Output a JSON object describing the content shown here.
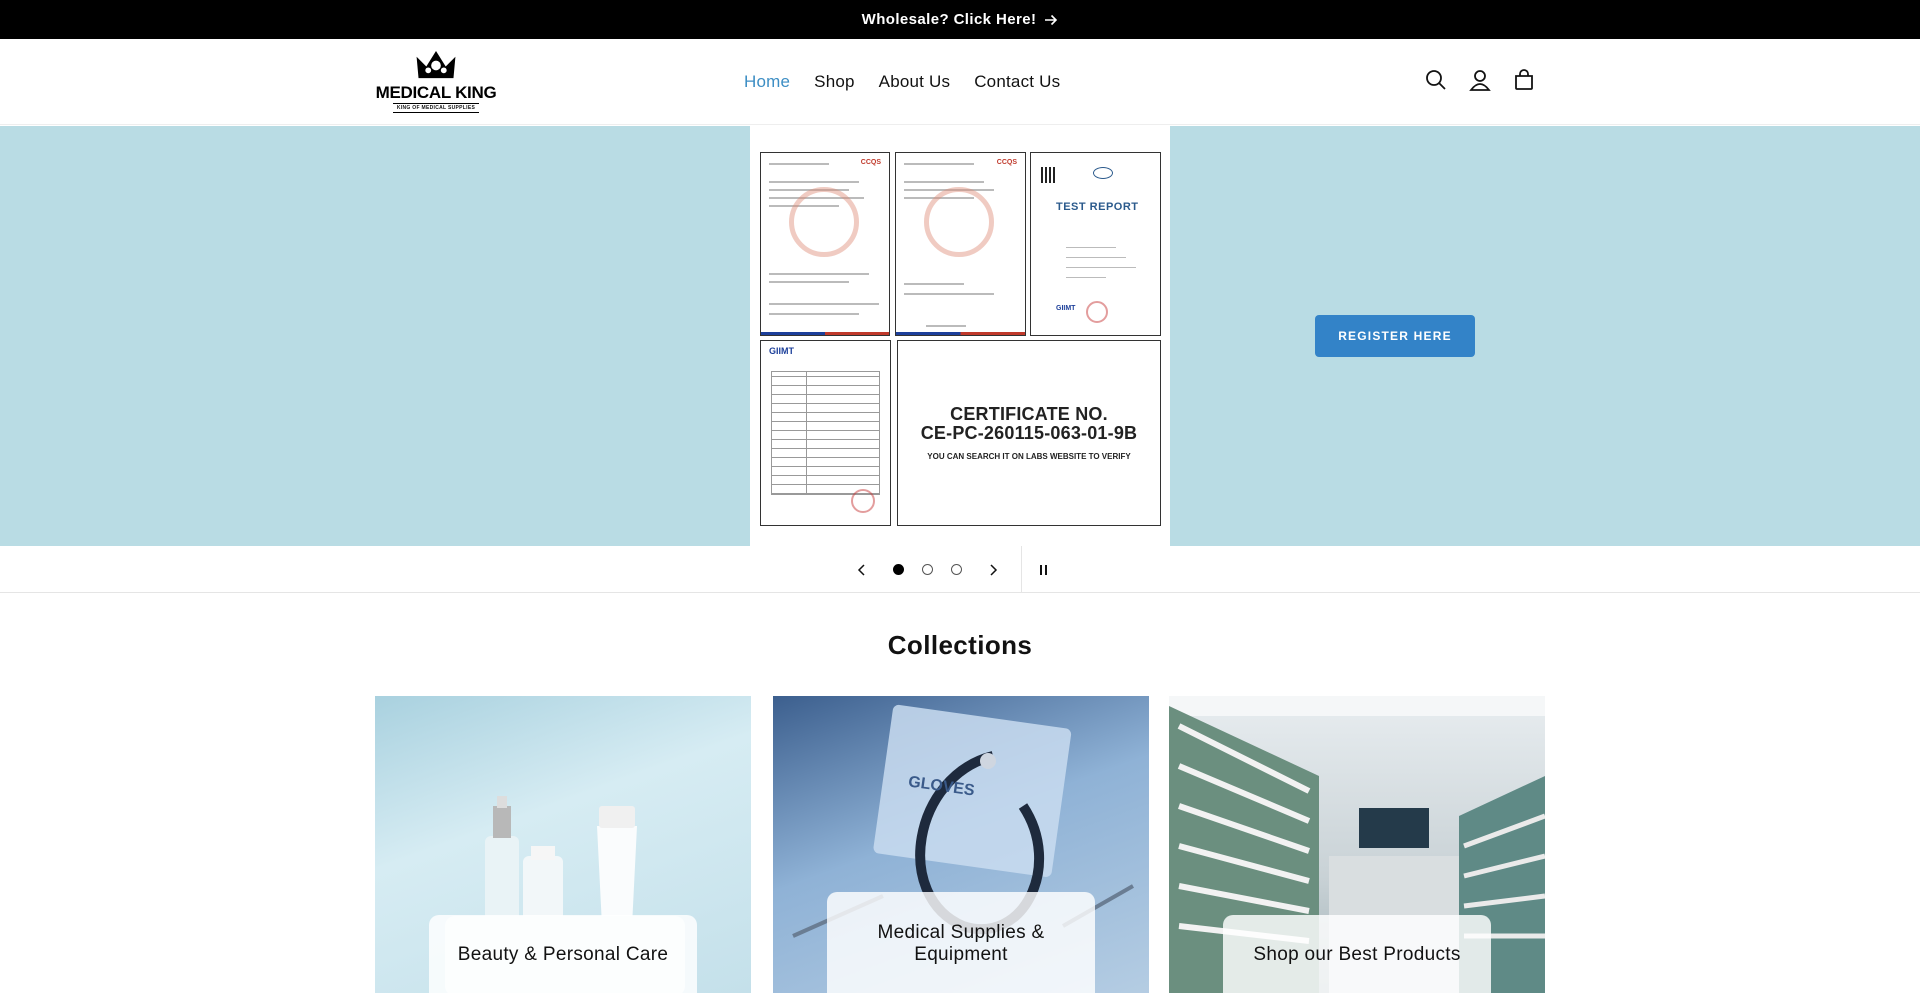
{
  "announcement": {
    "text": "Wholesale? Click Here!",
    "arrow_icon": "arrow-right-icon"
  },
  "header": {
    "logo": {
      "text": "MEDICAL KING",
      "tagline": "KING OF MEDICAL SUPPLIES"
    },
    "nav": [
      {
        "label": "Home",
        "active": true
      },
      {
        "label": "Shop",
        "active": false
      },
      {
        "label": "About Us",
        "active": false
      },
      {
        "label": "Contact Us",
        "active": false
      }
    ],
    "icons": [
      "search-icon",
      "account-icon",
      "cart-icon"
    ]
  },
  "hero": {
    "background": "#b9dce4",
    "certificate_text": "CERTIFICATE NO.",
    "certificate_number": "CE-PC-260115-063-01-9B",
    "certificate_note": "YOU CAN SEARCH IT ON LABS WEBSITE TO VERIFY",
    "report_title": "TEST  REPORT",
    "brand_ccqs": "CCQS",
    "brand_gimt": "GIIMT",
    "button_label": "REGISTER HERE",
    "button_color": "#3383c8"
  },
  "slider": {
    "slide_count": 3,
    "current": 1
  },
  "collections": {
    "title": "Collections",
    "items": [
      {
        "label": "Beauty & Personal Care"
      },
      {
        "label": "Medical Supplies & Equipment"
      },
      {
        "label": "Shop our Best Products"
      }
    ]
  },
  "colors": {
    "accent": "#3d8ec4",
    "announcement_bg": "#000000"
  }
}
